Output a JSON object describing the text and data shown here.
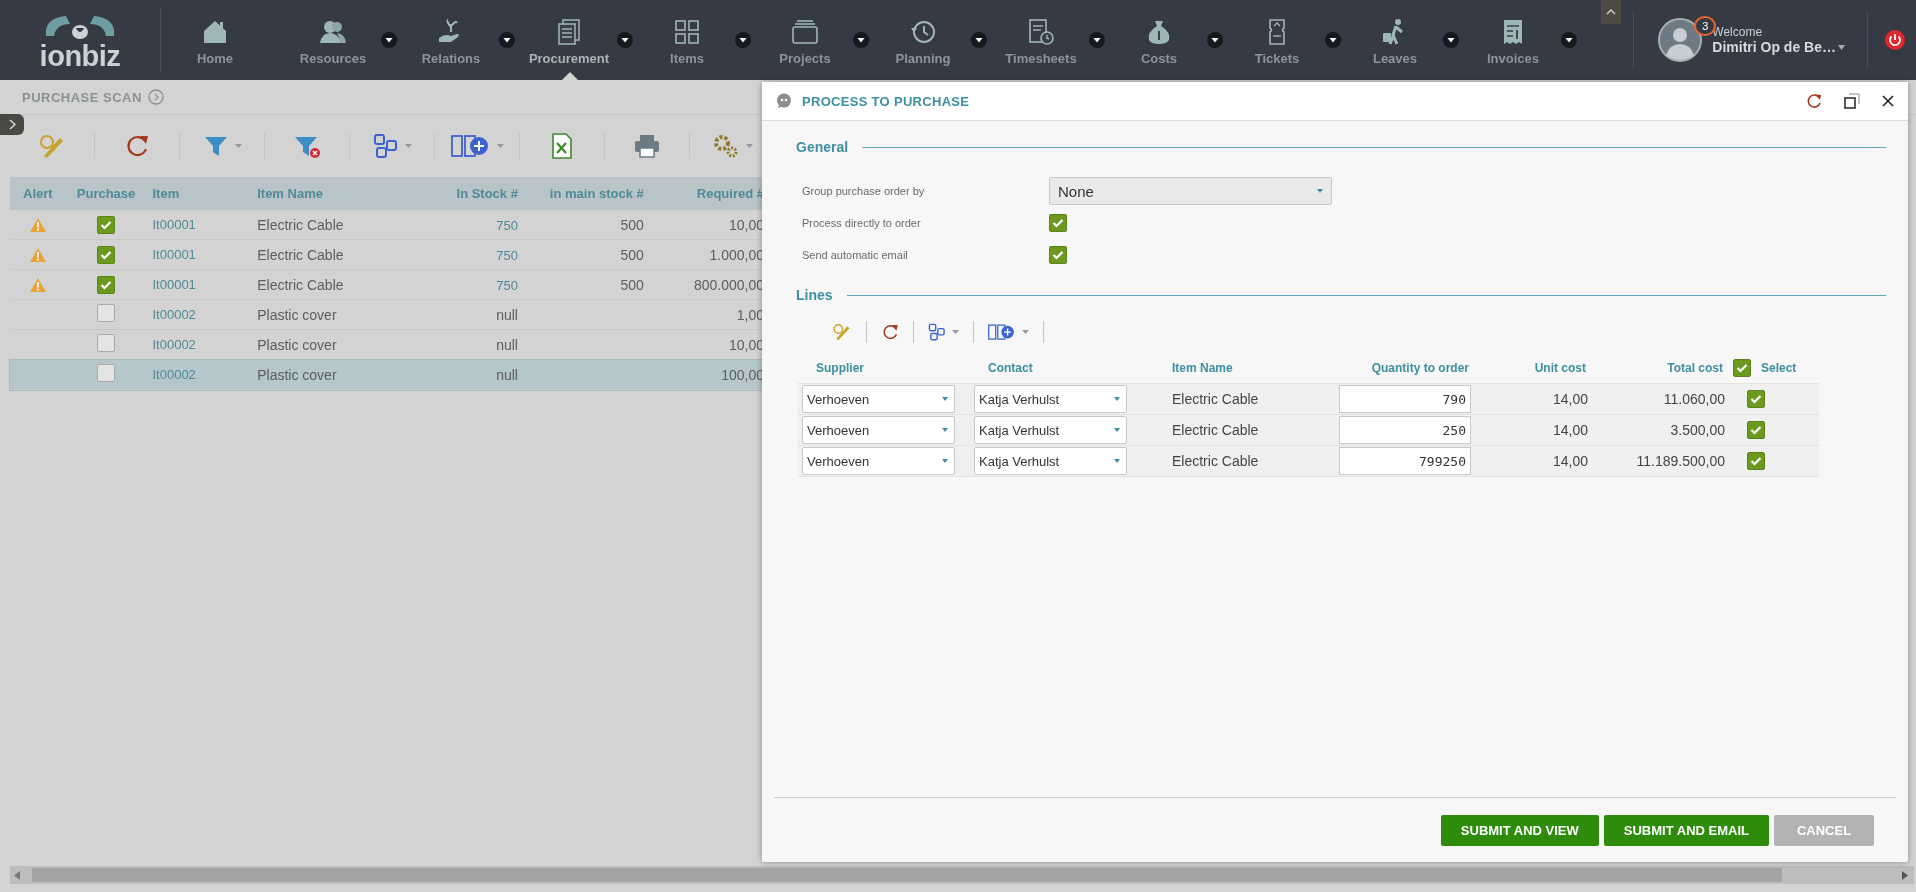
{
  "nav": {
    "items": [
      {
        "label": "Home",
        "dropdown": false,
        "selected": false
      },
      {
        "label": "Resources",
        "dropdown": true,
        "selected": false
      },
      {
        "label": "Relations",
        "dropdown": true,
        "selected": false
      },
      {
        "label": "Procurement",
        "dropdown": true,
        "selected": true
      },
      {
        "label": "Items",
        "dropdown": true,
        "selected": false
      },
      {
        "label": "Projects",
        "dropdown": true,
        "selected": false
      },
      {
        "label": "Planning",
        "dropdown": true,
        "selected": false
      },
      {
        "label": "Timesheets",
        "dropdown": true,
        "selected": false
      },
      {
        "label": "Costs",
        "dropdown": true,
        "selected": false
      },
      {
        "label": "Tickets",
        "dropdown": true,
        "selected": false
      },
      {
        "label": "Leaves",
        "dropdown": true,
        "selected": false
      },
      {
        "label": "Invoices",
        "dropdown": true,
        "selected": false
      }
    ]
  },
  "user": {
    "notifications": "3",
    "greeting": "Welcome",
    "name": "Dimitri Op de Be…"
  },
  "logo": {
    "text": "ionbiz"
  },
  "page": {
    "title": "PURCHASE SCAN",
    "table": {
      "columns": [
        "Alert",
        "Purchase",
        "Item",
        "Item Name",
        "In Stock #",
        "in main stock #",
        "Required #"
      ],
      "rows": [
        {
          "alert": true,
          "purchase": true,
          "item": "It00001",
          "item_name": "Electric Cable",
          "in_stock": "750",
          "in_stock_link": true,
          "in_main_stock": "500",
          "required": "10,00",
          "selected": false
        },
        {
          "alert": true,
          "purchase": true,
          "item": "It00001",
          "item_name": "Electric Cable",
          "in_stock": "750",
          "in_stock_link": true,
          "in_main_stock": "500",
          "required": "1.000,00",
          "selected": false
        },
        {
          "alert": true,
          "purchase": true,
          "item": "It00001",
          "item_name": "Electric Cable",
          "in_stock": "750",
          "in_stock_link": true,
          "in_main_stock": "500",
          "required": "800.000,00",
          "selected": false
        },
        {
          "alert": false,
          "purchase": false,
          "item": "It00002",
          "item_name": "Plastic cover",
          "in_stock": "null",
          "in_stock_link": false,
          "required": "1,00",
          "selected": false
        },
        {
          "alert": false,
          "purchase": false,
          "item": "It00002",
          "item_name": "Plastic cover",
          "in_stock": "null",
          "in_stock_link": false,
          "required": "10,00",
          "selected": false
        },
        {
          "alert": false,
          "purchase": false,
          "item": "It00002",
          "item_name": "Plastic cover",
          "in_stock": "null",
          "in_stock_link": false,
          "required": "100,00",
          "selected": true
        }
      ]
    }
  },
  "dialog": {
    "title": "PROCESS TO PURCHASE",
    "general": {
      "heading": "General",
      "fields": [
        {
          "kind": "select",
          "label": "Group purchase order by",
          "value": "None"
        },
        {
          "kind": "checkbox",
          "label": "Process directly to order",
          "checked": true
        },
        {
          "kind": "checkbox",
          "label": "Send automatic email",
          "checked": true
        }
      ]
    },
    "lines": {
      "heading": "Lines",
      "columns": [
        "Supplier",
        "Contact",
        "Item Name",
        "Quantity to order",
        "Unit cost",
        "Total cost",
        "Select"
      ],
      "select_all": true,
      "rows": [
        {
          "supplier": "Verhoeven",
          "contact": "Katja Verhulst",
          "item_name": "Electric Cable",
          "quantity": "790",
          "unit_cost": "14,00",
          "total_cost": "11.060,00",
          "selected": true
        },
        {
          "supplier": "Verhoeven",
          "contact": "Katja Verhulst",
          "item_name": "Electric Cable",
          "quantity": "250",
          "unit_cost": "14,00",
          "total_cost": "3.500,00",
          "selected": true
        },
        {
          "supplier": "Verhoeven",
          "contact": "Katja Verhulst",
          "item_name": "Electric Cable",
          "quantity": "799250",
          "unit_cost": "14,00",
          "total_cost": "11.189.500,00",
          "selected": true
        }
      ]
    },
    "buttons": [
      {
        "label": "SUBMIT AND VIEW",
        "kind": "primary"
      },
      {
        "label": "SUBMIT AND EMAIL",
        "kind": "primary"
      },
      {
        "label": "CANCEL",
        "kind": "secondary"
      }
    ]
  }
}
